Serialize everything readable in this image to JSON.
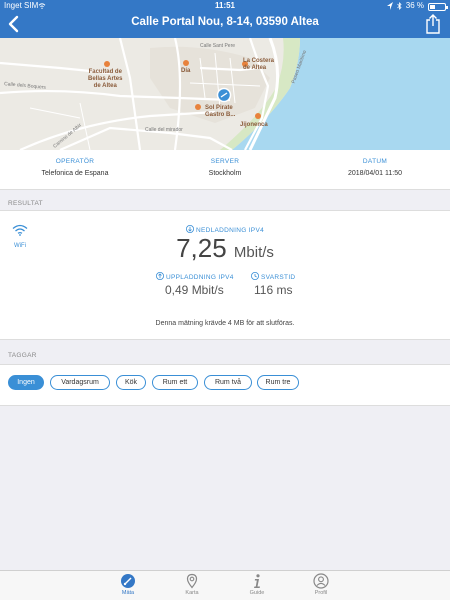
{
  "status_bar": {
    "carrier": "Inget SIM",
    "time": "11:51",
    "battery": "36 %"
  },
  "nav": {
    "title": "Calle Portal Nou, 8-14, 03590 Altea"
  },
  "map": {
    "labels": {
      "poi_faculty": "Facultad de\nBellas Artes\nde Altea",
      "poi_castera": "La Costera\nde Altea",
      "poi_dia": "Día",
      "poi_pirate": "Sol Pirate\nGastro B...",
      "poi_jijonenca": "Jijonenca"
    },
    "streets": [
      "Paseo Maritimo",
      "Calle Sant Pere",
      "Calle dels Boquers",
      "Camino de Albir",
      "Calle del mirador"
    ],
    "colors": {
      "land": "#eceae4",
      "sea": "#a8d8f0",
      "road": "#ffffff",
      "poi": "#e8823c",
      "pin": "#3a8fd6"
    }
  },
  "info": {
    "operator_label": "OPERATÖR",
    "operator_value": "Telefonica de Espana",
    "server_label": "SERVER",
    "server_value": "Stockholm",
    "date_label": "DATUM",
    "date_value": "2018/04/01 11:50"
  },
  "result": {
    "section_label": "RESULTAT",
    "connection": "WiFi",
    "download_label": "NEDLADDNING IPV4",
    "download_value": "7,25",
    "download_unit": "Mbit/s",
    "upload_label": "UPPLADDNING IPV4",
    "upload_value": "0,49 Mbit/s",
    "latency_label": "SVARSTID",
    "latency_value": "116 ms",
    "note": "Denna mätning krävde 4 MB för att slutföras."
  },
  "tags": {
    "section_label": "TAGGAR",
    "items": [
      "Ingen",
      "Vardagsrum",
      "Kök",
      "Rum ett",
      "Rum två",
      "Rum tre"
    ],
    "selected": "Ingen"
  },
  "tabbar": {
    "items": [
      "Mäta",
      "Karta",
      "Guide",
      "Profil"
    ],
    "selected": "Mäta"
  },
  "colors": {
    "accent": "#3a8fd6",
    "nav": "#3478c6"
  }
}
